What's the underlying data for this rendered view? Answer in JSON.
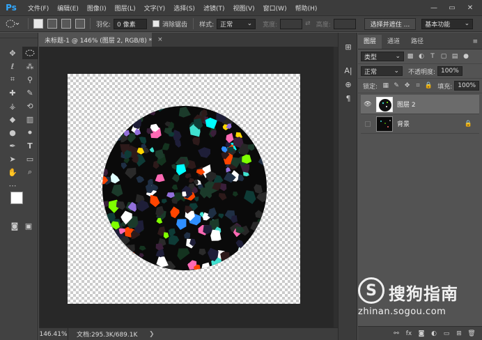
{
  "app": {
    "logo": "Ps",
    "brand_color": "#31a8ff"
  },
  "menu": [
    "文件(F)",
    "编辑(E)",
    "图像(I)",
    "图层(L)",
    "文字(Y)",
    "选择(S)",
    "滤镜(T)",
    "视图(V)",
    "窗口(W)",
    "帮助(H)"
  ],
  "window_controls": {
    "minimize": "—",
    "restore": "▭",
    "close": "✕"
  },
  "options": {
    "feather_label": "羽化:",
    "feather_value": "0 像素",
    "antialias_label": "消除锯齿",
    "antialias_checked": true,
    "style_label": "样式:",
    "style_value": "正常",
    "width_label": "宽度:",
    "height_label": "高度:",
    "swap_icon": "⇄",
    "select_mask_button": "选择并遮住 ...",
    "workspace_value": "基本功能"
  },
  "tools": [
    "move-icon",
    "marquee-icon",
    "lasso-icon",
    "quick-select-icon",
    "crop-icon",
    "eyedropper-icon",
    "healing-icon",
    "brush-icon",
    "stamp-icon",
    "history-brush-icon",
    "eraser-icon",
    "gradient-icon",
    "blur-icon",
    "dodge-icon",
    "pen-icon",
    "type-icon",
    "path-select-icon",
    "shape-icon",
    "hand-icon",
    "zoom-icon"
  ],
  "colors": {
    "foreground": "#ffffff",
    "background": "#000000"
  },
  "document": {
    "tab_title": "未标题-1 @ 146% (图层 2, RGB/8) *",
    "close": "×",
    "zoom": "146.41%",
    "doc_info": "文档:295.3K/689.1K"
  },
  "panel": {
    "tabs": [
      "图层",
      "通道",
      "路径"
    ],
    "filter_kind": "类型",
    "blend_mode": "正常",
    "opacity_label": "不透明度:",
    "opacity_value": "100%",
    "lock_label": "锁定:",
    "fill_label": "填充:",
    "fill_value": "100%",
    "layers": [
      {
        "name": "图层 2",
        "visible": true,
        "selected": true
      },
      {
        "name": "背景",
        "visible": false,
        "selected": false,
        "locked": true
      }
    ]
  },
  "watermark": {
    "logo": "S",
    "name": "搜狗指南",
    "url": "zhinan.sogou.com"
  }
}
